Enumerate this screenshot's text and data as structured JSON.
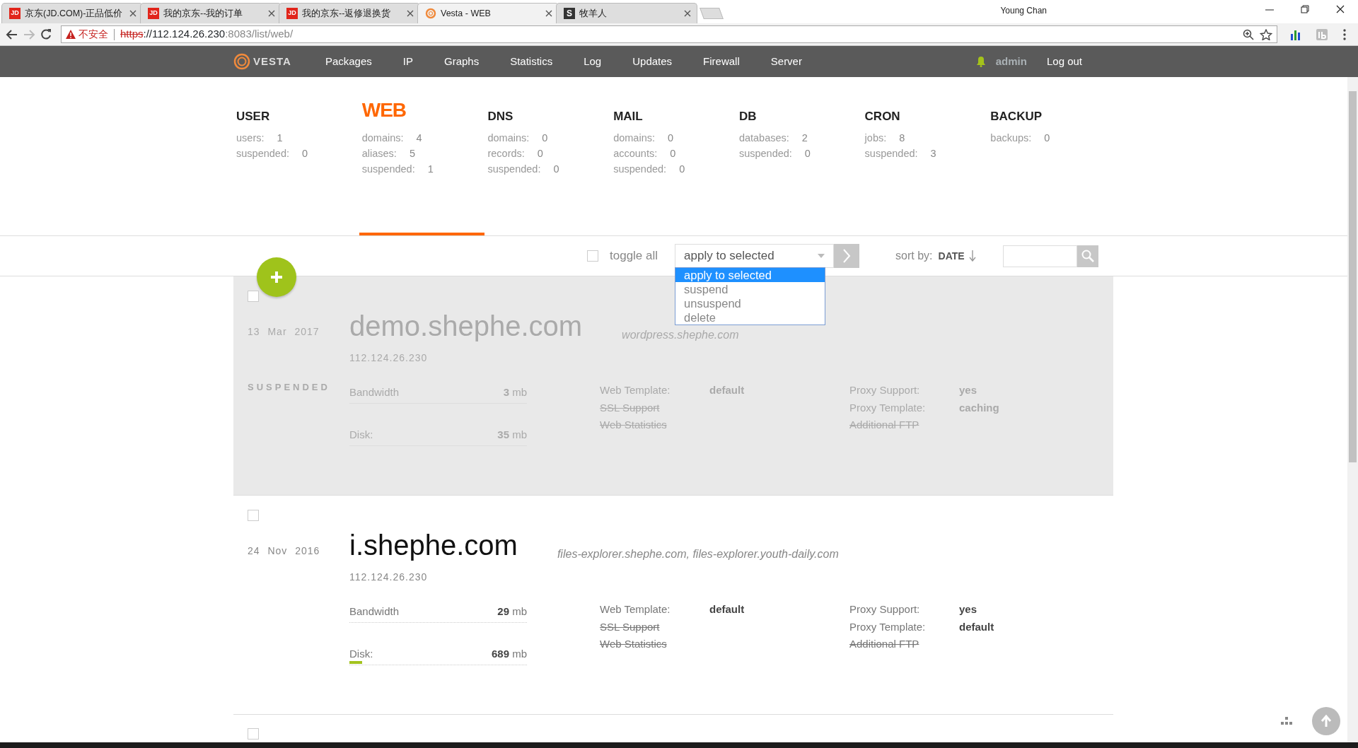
{
  "browser": {
    "tabs": [
      {
        "kind": "letters",
        "icon_text": "JD",
        "title": "京东(JD.COM)-正品低价",
        "selected": false
      },
      {
        "kind": "letters",
        "icon_text": "JD",
        "title": "我的京东--我的订单",
        "selected": false
      },
      {
        "kind": "letters",
        "icon_text": "JD",
        "title": "我的京东--返修退换货",
        "selected": false
      },
      {
        "kind": "ring",
        "title": "Vesta - WEB",
        "selected": true
      },
      {
        "kind": "dark",
        "icon_text": "S",
        "title": "牧羊人",
        "selected": false
      }
    ],
    "profile": "Young Chan",
    "address": {
      "warning": "不安全",
      "scheme": "https",
      "host": "://112.124.26.230",
      "rest": ":8083/list/web/"
    }
  },
  "nav": {
    "logo": "VESTA",
    "items": [
      "Packages",
      "IP",
      "Graphs",
      "Statistics",
      "Log",
      "Updates",
      "Firewall",
      "Server"
    ],
    "user": "admin",
    "logout": "Log out"
  },
  "stats": [
    {
      "title": "USER",
      "selected": false,
      "items": [
        {
          "label": "users:",
          "value": "1"
        },
        {
          "label": "suspended:",
          "value": "0"
        }
      ]
    },
    {
      "title": "WEB",
      "selected": true,
      "items": [
        {
          "label": "domains:",
          "value": "4"
        },
        {
          "label": "aliases:",
          "value": "5"
        },
        {
          "label": "suspended:",
          "value": "1"
        }
      ]
    },
    {
      "title": "DNS",
      "selected": false,
      "items": [
        {
          "label": "domains:",
          "value": "0"
        },
        {
          "label": "records:",
          "value": "0"
        },
        {
          "label": "suspended:",
          "value": "0"
        }
      ]
    },
    {
      "title": "MAIL",
      "selected": false,
      "items": [
        {
          "label": "domains:",
          "value": "0"
        },
        {
          "label": "accounts:",
          "value": "0"
        },
        {
          "label": "suspended:",
          "value": "0"
        }
      ]
    },
    {
      "title": "DB",
      "selected": false,
      "items": [
        {
          "label": "databases:",
          "value": "2"
        },
        {
          "label": "suspended:",
          "value": "0"
        }
      ]
    },
    {
      "title": "CRON",
      "selected": false,
      "items": [
        {
          "label": "jobs:",
          "value": "8"
        },
        {
          "label": "suspended:",
          "value": "3"
        }
      ]
    },
    {
      "title": "BACKUP",
      "selected": false,
      "items": [
        {
          "label": "backups:",
          "value": "0"
        }
      ]
    }
  ],
  "toolbar": {
    "toggle_all": {
      "label": "toggle all",
      "checked": false
    },
    "bulk_action": {
      "value": "apply to selected",
      "expanded": true,
      "options": [
        {
          "label": "apply to selected",
          "selected": true
        },
        {
          "label": "suspend",
          "selected": false
        },
        {
          "label": "unsuspend",
          "selected": false
        },
        {
          "label": "delete",
          "selected": false
        }
      ]
    },
    "sort": {
      "label": "sort by:",
      "value": "DATE"
    }
  },
  "domains": [
    {
      "checked": false,
      "suspended": true,
      "status": "SUSPENDED",
      "date": [
        "13",
        "Mar",
        "2017"
      ],
      "name": "demo.shephe.com",
      "aliases": "wordpress.shephe.com",
      "ip": "112.124.26.230",
      "usage": [
        {
          "label": "Bandwidth",
          "value": "3",
          "unit": "mb"
        },
        {
          "label": "Disk:",
          "value": "35",
          "unit": "mb"
        }
      ],
      "settings": [
        [
          {
            "label": "Web Template:",
            "value": "default",
            "enabled": true
          },
          {
            "label": "SSL Support",
            "enabled": false
          },
          {
            "label": "Web Statistics",
            "enabled": false
          }
        ],
        [
          {
            "label": "Proxy Support:",
            "value": "yes",
            "enabled": true
          },
          {
            "label": "Proxy Template:",
            "value": "caching",
            "enabled": true
          },
          {
            "label": "Additional FTP",
            "enabled": false
          }
        ]
      ]
    },
    {
      "checked": false,
      "suspended": false,
      "date": [
        "24",
        "Nov",
        "2016"
      ],
      "name": "i.shephe.com",
      "aliases": "files-explorer.shephe.com, files-explorer.youth-daily.com",
      "ip": "112.124.26.230",
      "usage": [
        {
          "label": "Bandwidth",
          "value": "29",
          "unit": "mb"
        },
        {
          "label": "Disk:",
          "value": "689",
          "unit": "mb",
          "level": 0.07
        }
      ],
      "settings": [
        [
          {
            "label": "Web Template:",
            "value": "default",
            "enabled": true
          },
          {
            "label": "SSL Support",
            "enabled": false
          },
          {
            "label": "Web Statistics",
            "enabled": false
          }
        ],
        [
          {
            "label": "Proxy Support:",
            "value": "yes",
            "enabled": true
          },
          {
            "label": "Proxy Template:",
            "value": "default",
            "enabled": true
          },
          {
            "label": "Additional FTP",
            "enabled": false
          }
        ]
      ]
    }
  ],
  "next_row": {
    "checked": false
  }
}
